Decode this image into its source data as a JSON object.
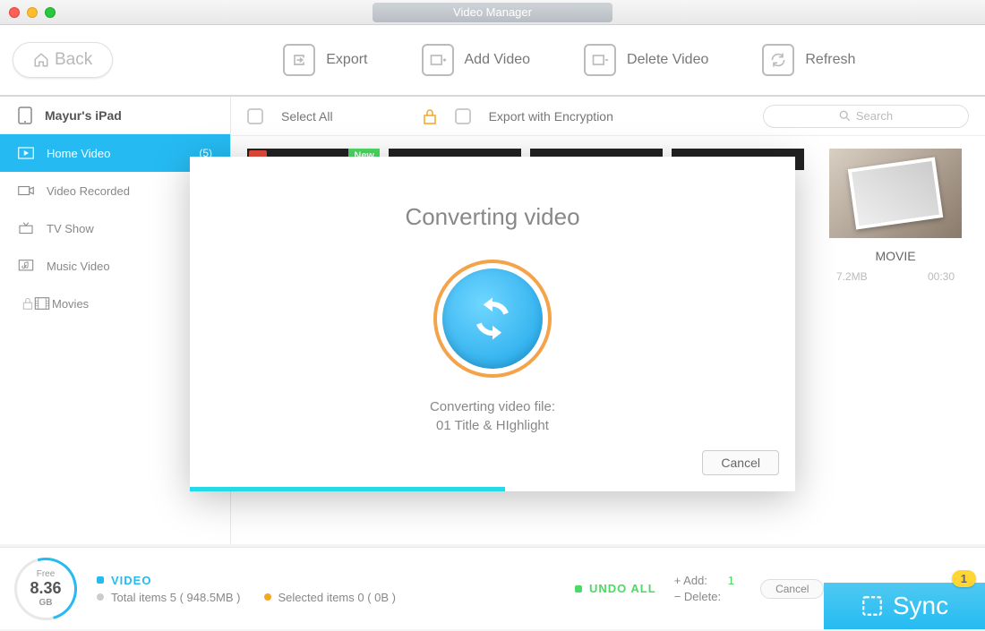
{
  "window": {
    "title": "Video Manager"
  },
  "header": {
    "back": "Back",
    "tools": {
      "export": "Export",
      "add": "Add Video",
      "delete": "Delete Video",
      "refresh": "Refresh"
    }
  },
  "sidebar": {
    "device": "Mayur's iPad",
    "items": [
      {
        "label": "Home Video",
        "count": "(5)"
      },
      {
        "label": "Video Recorded"
      },
      {
        "label": "TV Show"
      },
      {
        "label": "Music Video"
      },
      {
        "label": "Movies"
      }
    ]
  },
  "filterbar": {
    "select_all": "Select All",
    "encrypt": "Export with Encryption",
    "search_placeholder": "Search"
  },
  "thumb_badges": {
    "undo": "⤺",
    "new": "New"
  },
  "card": {
    "title": "MOVIE",
    "size": "7.2MB",
    "duration": "00:30"
  },
  "footer": {
    "gauge": {
      "free": "Free",
      "value": "8.36",
      "unit": "GB"
    },
    "video_label": "VIDEO",
    "total": "Total items 5 ( 948.5MB )",
    "selected": "Selected items 0 ( 0B )",
    "undo_all": "UNDO ALL",
    "add_label": "+ Add:",
    "add_value": "1",
    "del_label": "− Delete:",
    "del_value": "",
    "cancel": "Cancel",
    "sync": "Sync",
    "badge": "1"
  },
  "dialog": {
    "title": "Converting video",
    "line1": "Converting video file:",
    "line2": "01 Title & HIghlight",
    "cancel": "Cancel"
  }
}
